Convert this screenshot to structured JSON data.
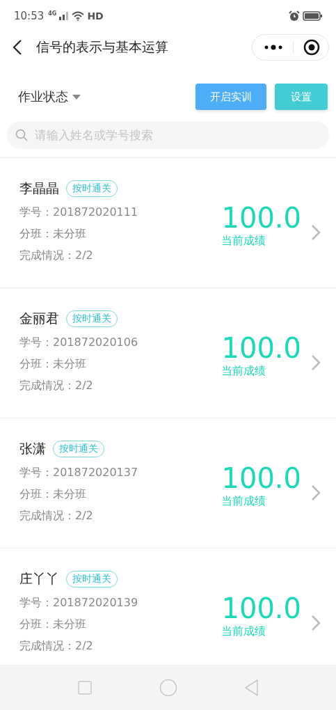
{
  "status_bar": {
    "time": "10:53",
    "network": "4G",
    "wifi_label": "HD"
  },
  "nav": {
    "title": "信号的表示与基本运算"
  },
  "toolbar": {
    "filter": "作业状态",
    "buttons": [
      {
        "label": "开启实训",
        "kind": "primary"
      },
      {
        "label": "设置",
        "kind": "secondary"
      }
    ]
  },
  "search": {
    "placeholder": "请输入姓名或学号搜索"
  },
  "students": [
    {
      "name": "李晶晶",
      "tag": "按时通关",
      "id_line": "学号：201872020111",
      "class_line": "分班：未分班",
      "progress_line": "完成情况：2/2",
      "score": "100.0",
      "score_label": "当前成绩"
    },
    {
      "name": "金丽君",
      "tag": "按时通关",
      "id_line": "学号：201872020106",
      "class_line": "分班：未分班",
      "progress_line": "完成情况：2/2",
      "score": "100.0",
      "score_label": "当前成绩"
    },
    {
      "name": "张潇",
      "tag": "按时通关",
      "id_line": "学号：201872020137",
      "class_line": "分班：未分班",
      "progress_line": "完成情况：2/2",
      "score": "100.0",
      "score_label": "当前成绩"
    },
    {
      "name": "庄丫丫",
      "tag": "按时通关",
      "id_line": "学号：201872020139",
      "class_line": "分班：未分班",
      "progress_line": "完成情况：2/2",
      "score": "100.0",
      "score_label": "当前成绩"
    }
  ]
}
